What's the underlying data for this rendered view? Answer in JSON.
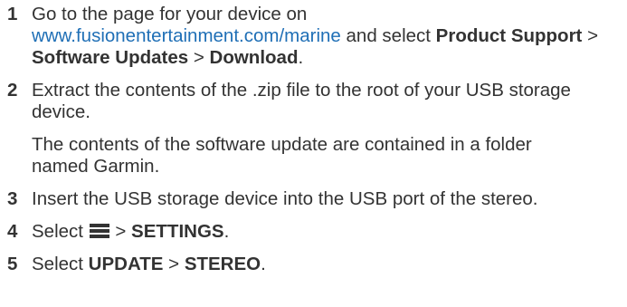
{
  "steps": [
    {
      "number": "1",
      "text_before": "Go to the page for your device on",
      "link": "www.fusionentertainment.com/marine",
      "text_after": " and select ",
      "menu1": "Product Support",
      "sep1": " > ",
      "menu2": "Software Updates",
      "sep2": " > ",
      "menu3": "Download",
      "end": "."
    },
    {
      "number": "2",
      "text": "Extract the contents of the .zip file to the root of your USB storage device.",
      "note": "The contents of the software update are contained in a folder named Garmin."
    },
    {
      "number": "3",
      "text": "Insert the USB storage device into the USB port of the stereo."
    },
    {
      "number": "4",
      "prefix": "Select ",
      "icon": "menu-icon",
      "sep": " > ",
      "menu": "SETTINGS",
      "end": "."
    },
    {
      "number": "5",
      "prefix": "Select ",
      "menu1": "UPDATE",
      "sep": " > ",
      "menu2": "STEREO",
      "end": "."
    }
  ]
}
